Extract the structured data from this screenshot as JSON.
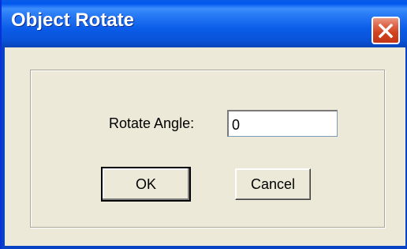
{
  "window": {
    "title": "Object Rotate"
  },
  "form": {
    "angle_label": "Rotate Angle:",
    "angle_value": "0"
  },
  "buttons": {
    "ok_label": "OK",
    "cancel_label": "Cancel"
  },
  "icons": {
    "close": "close-icon"
  },
  "colors": {
    "titlebar": "#0a5be8",
    "close_button": "#d1421f",
    "dialog_background": "#ece9d8"
  }
}
